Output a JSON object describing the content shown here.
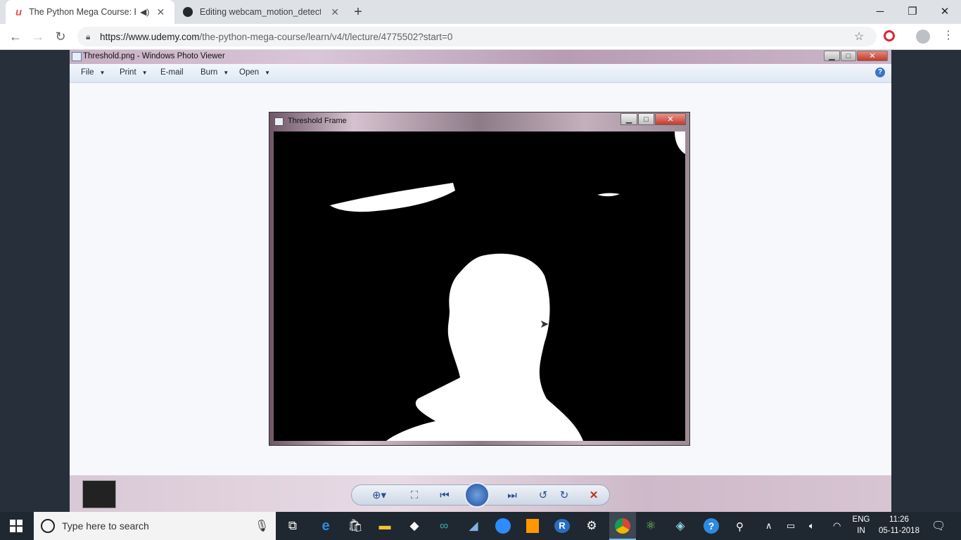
{
  "browser": {
    "tabs": [
      {
        "title": "The Python Mega Course: Bu",
        "active": true
      },
      {
        "title": "Editing webcam_motion_detecto",
        "active": false
      }
    ],
    "url_domain": "https://www.udemy.com",
    "url_path": "/the-python-mega-course/learn/v4/t/lecture/4775502?start=0"
  },
  "photo_viewer": {
    "title": "Threshold.png - Windows Photo Viewer",
    "menu": [
      "File",
      "Print",
      "E-mail",
      "Burn",
      "Open"
    ],
    "help": "?"
  },
  "inner_window": {
    "title": "Threshold Frame"
  },
  "taskbar": {
    "search_placeholder": "Type here to search",
    "lang_top": "ENG",
    "lang_bottom": "IN",
    "time": "11:26",
    "date": "05-11-2018"
  },
  "icons": [
    "udemy-icon",
    "github-icon",
    "plus-icon",
    "back-icon",
    "forward-icon",
    "reload-icon",
    "lock-icon",
    "star-icon",
    "profile-icon",
    "windows-icon",
    "mic-icon",
    "task-view-icon",
    "edge-icon",
    "store-icon",
    "explorer-icon",
    "dropbox-icon",
    "arduino-icon",
    "files-icon",
    "zoom-icon",
    "sublime-icon",
    "r-icon",
    "settings-icon",
    "chrome-icon",
    "atom-icon",
    "git-icon",
    "help-icon",
    "people-icon"
  ],
  "colors": {
    "chrome_tabstrip": "#dee1e6",
    "taskbar": "#1f2830",
    "udemy_accent": "#ec5252",
    "close_red": "#d9272e"
  }
}
